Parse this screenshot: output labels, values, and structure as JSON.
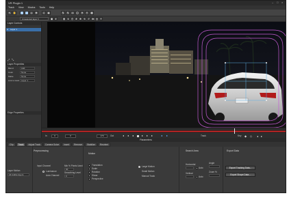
{
  "app": {
    "title": "VR Plugin 1"
  },
  "menu": [
    "Track",
    "View",
    "Mocha",
    "Tools",
    "Help"
  ],
  "toolbar": {
    "layer_select": "Unselected layer",
    "zoom": "100%",
    "frame_current": "0",
    "frame_start": "0",
    "frame_end": "170"
  },
  "left_panel": {
    "layer_controls_title": "Layer Controls",
    "layer_name": "Layer 1",
    "layer_properties_title": "Layer Properties",
    "props": [
      {
        "label": "Blend",
        "value": "Add"
      },
      {
        "label": "Color",
        "value": "None"
      },
      {
        "label": "Matte",
        "value": "None"
      },
      {
        "label": "Link to track",
        "value": "Layer 1"
      }
    ],
    "edge_properties_title": "Edge Properties"
  },
  "timeline": {
    "in_label": "In",
    "out_label": "Out",
    "key_label": "Key",
    "track_label": "Track"
  },
  "params_header": "Parameters",
  "tabs": [
    "Clip",
    "Track",
    "Adjust Track",
    "Camera Solve",
    "Insert",
    "Remove",
    "Stabilize",
    "Reorient"
  ],
  "params": {
    "preprocessing": {
      "title": "Preprocessing",
      "input_channel_label": "Input Channel",
      "luminance": "Luminance",
      "auto_channel": "Auto Channel",
      "min_pixels_label": "Min % Pixels Used",
      "min_pixels_value": "30",
      "smoothing_label": "Smoothing Level",
      "smoothing_value": "0"
    },
    "motion": {
      "title": "Motion",
      "options": [
        "Translation",
        "Scale",
        "Rotation",
        "Shear",
        "Perspective"
      ],
      "large_motion": "Large Motion",
      "small_motion": "Small Motion",
      "manual_track": "Manual Track"
    },
    "search_area": {
      "title": "Search Area",
      "horizontal": "Horizontal",
      "vertical": "Vertical",
      "auto": "Auto",
      "angle": "Angle",
      "zoom": "Zoom %"
    },
    "export": {
      "title": "Export Data",
      "tracking_button": "Export Tracking Data...",
      "shape_button": "Export Shape Data..."
    },
    "layer_mode": {
      "label": "Layer Motion",
      "value": "All visible layers"
    }
  }
}
